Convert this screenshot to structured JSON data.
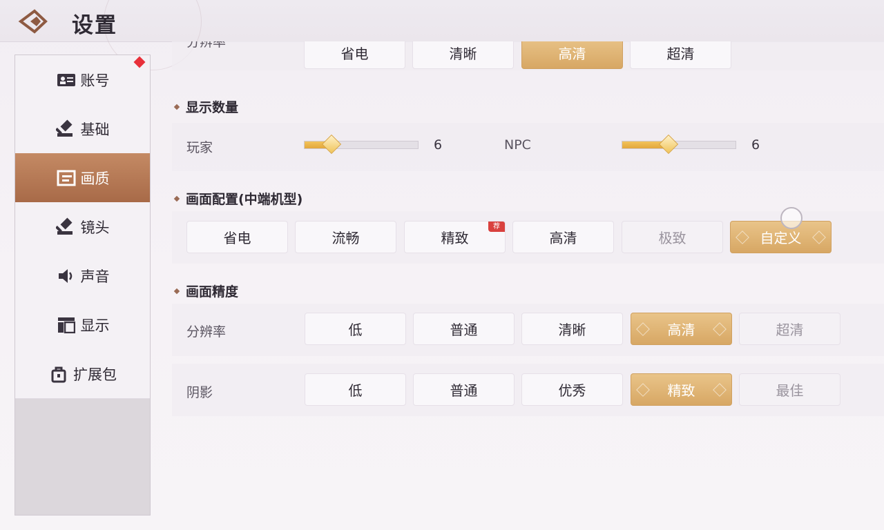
{
  "header": {
    "title": "设置"
  },
  "sidebar": {
    "items": [
      {
        "label": "账号",
        "icon": "id-card-icon",
        "badge": true
      },
      {
        "label": "基础",
        "icon": "gavel-icon"
      },
      {
        "label": "画质",
        "icon": "image-frame-icon",
        "active": true
      },
      {
        "label": "镜头",
        "icon": "gavel-icon"
      },
      {
        "label": "声音",
        "icon": "speaker-icon"
      },
      {
        "label": "显示",
        "icon": "layout-icon"
      },
      {
        "label": "扩展包",
        "icon": "bag-icon"
      }
    ]
  },
  "top_row": {
    "label": "分辨率",
    "options": [
      "省电",
      "清晰",
      "高清",
      "超清"
    ],
    "selected": "高清"
  },
  "display_count": {
    "title": "显示数量",
    "player": {
      "label": "玩家",
      "value": "6",
      "level": 0.23
    },
    "npc": {
      "label": "NPC",
      "value": "6",
      "level": 0.4
    }
  },
  "preset": {
    "title": "画面配置(中端机型)",
    "options": [
      "省电",
      "流畅",
      "精致",
      "高清",
      "极致",
      "自定义"
    ],
    "selected": "自定义",
    "disabled": [
      "极致"
    ],
    "recommended": {
      "option": "精致",
      "badge": "荐"
    }
  },
  "precision": {
    "title": "画面精度",
    "resolution": {
      "label": "分辨率",
      "options": [
        "低",
        "普通",
        "清晰",
        "高清",
        "超清"
      ],
      "selected": "高清",
      "disabled": [
        "超清"
      ]
    },
    "shadow": {
      "label": "阴影",
      "options": [
        "低",
        "普通",
        "优秀",
        "精致",
        "最佳"
      ],
      "selected": "精致",
      "disabled": [
        "最佳"
      ]
    }
  },
  "colors": {
    "accent": "#d7a764",
    "active_tab": "#b27452",
    "badge": "#d9413e"
  }
}
